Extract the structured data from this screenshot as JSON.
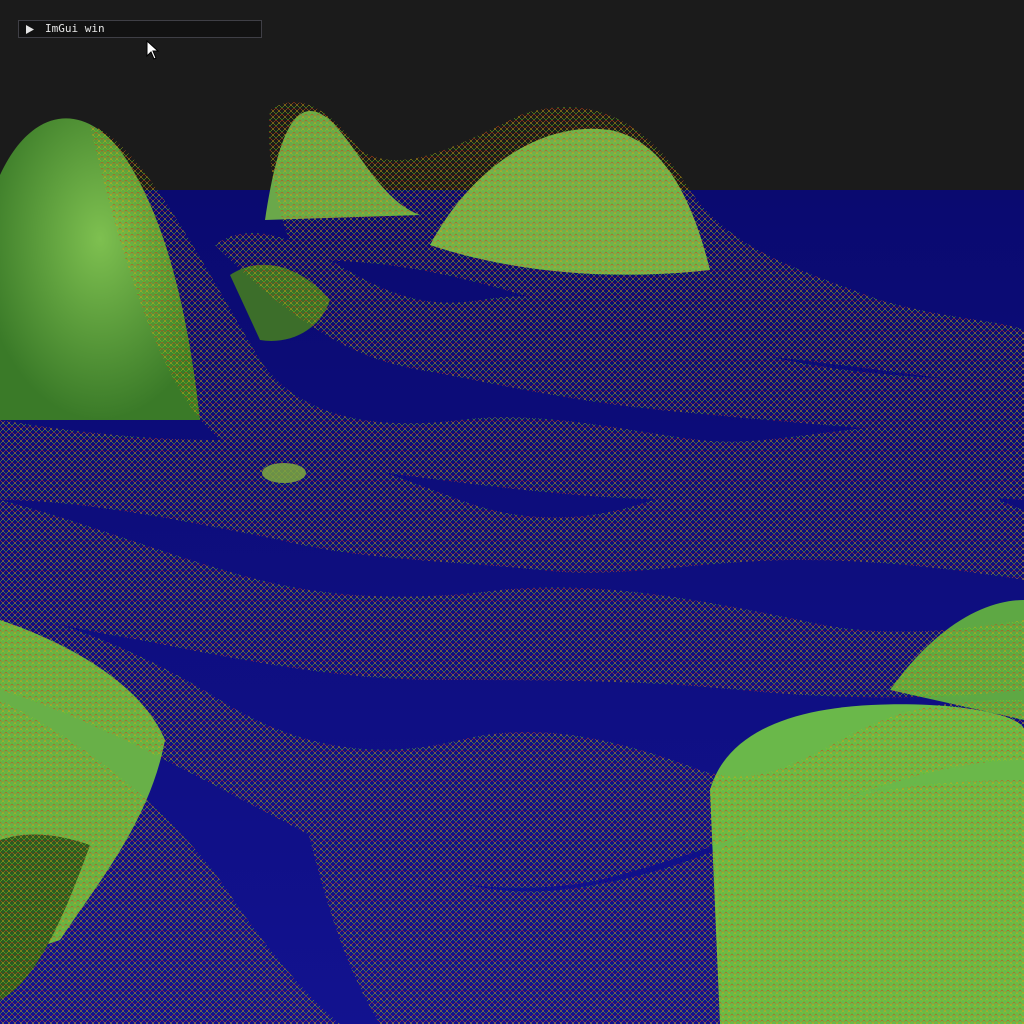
{
  "window": {
    "title": "ImGui win",
    "collapsed": true,
    "collapse_icon": "triangle-right-icon"
  },
  "scene": {
    "description_icon": "terrain-wireframe",
    "background_color": "#1b1b1b",
    "water_color": "#0a0a8c",
    "terrain_fill_color": "#5fae3f",
    "wire_color_near": "#3fd020",
    "wire_color_mid": "#c8c010",
    "wire_color_far": "#e02010"
  },
  "cursor": {
    "icon": "mouse-pointer-icon"
  }
}
